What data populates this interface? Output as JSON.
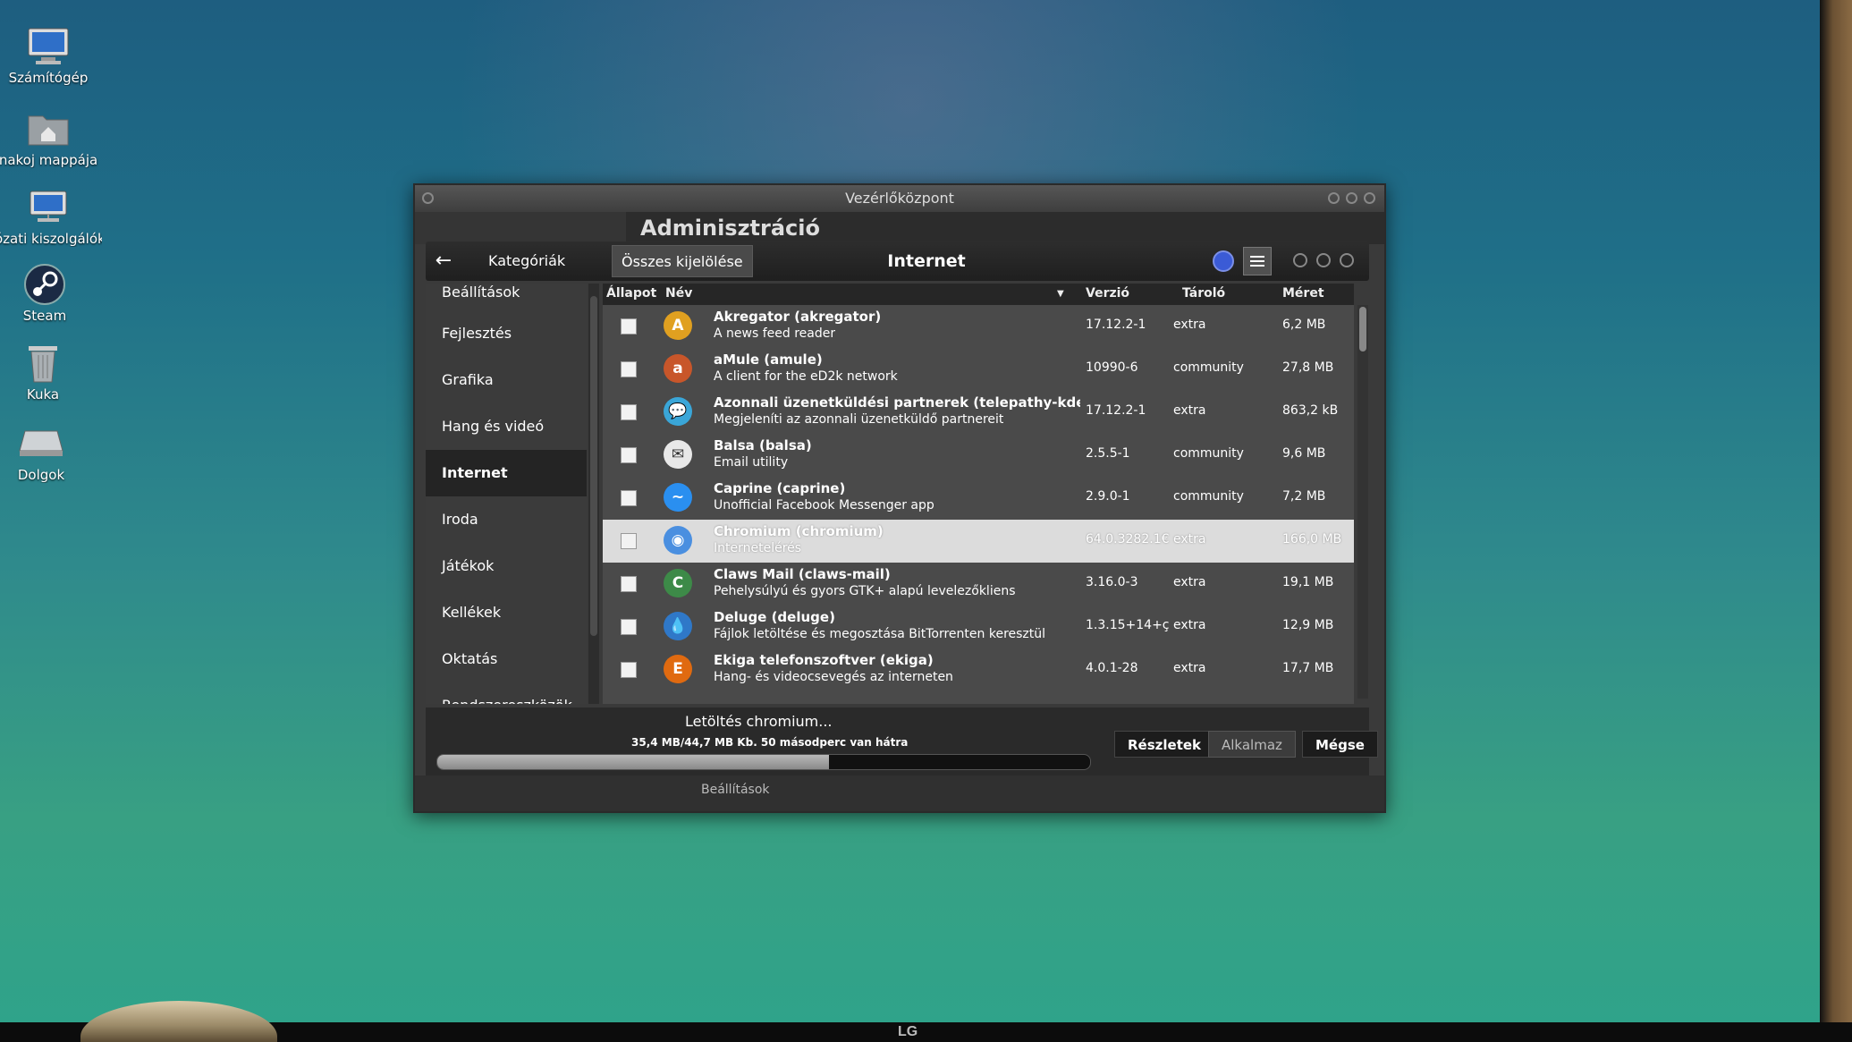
{
  "desktop": {
    "icons": [
      {
        "label": "Számítógép",
        "icon": "computer-icon"
      },
      {
        "label": "nakoj mappája",
        "icon": "home-folder-icon"
      },
      {
        "label": "ózati kiszolgálók",
        "icon": "network-icon"
      },
      {
        "label": "Steam",
        "icon": "steam-icon"
      },
      {
        "label": "Kuka",
        "icon": "trash-icon"
      },
      {
        "label": "Dolgok",
        "icon": "drive-icon"
      }
    ],
    "monitor_brand": "LG"
  },
  "window": {
    "title": "Vezérlőközpont",
    "section_title": "Adminisztráció"
  },
  "toolbar": {
    "back_icon": "back-arrow-icon",
    "categories_label": "Kategóriák",
    "select_all_label": "Összes kijelölése",
    "title": "Internet",
    "search_icon": "search-icon",
    "menu_icon": "hamburger-menu-icon"
  },
  "sidebar": {
    "items": [
      {
        "label": "Beállítások",
        "active": false
      },
      {
        "label": "Fejlesztés",
        "active": false
      },
      {
        "label": "Grafika",
        "active": false
      },
      {
        "label": "Hang és videó",
        "active": false
      },
      {
        "label": "Internet",
        "active": true
      },
      {
        "label": "Iroda",
        "active": false
      },
      {
        "label": "Játékok",
        "active": false
      },
      {
        "label": "Kellékek",
        "active": false
      },
      {
        "label": "Oktatás",
        "active": false
      },
      {
        "label": "Rendszereszközök",
        "active": false
      }
    ]
  },
  "table": {
    "headers": {
      "status": "Állapot",
      "name": "Név",
      "version": "Verzió",
      "repo": "Tároló",
      "size": "Méret"
    },
    "rows": [
      {
        "name": "Akregator  (akregator)",
        "desc": "A news feed reader",
        "version": "17.12.2-1",
        "repo": "extra",
        "size": "6,2 MB",
        "icon_color": "#e0a020",
        "icon_glyph": "A",
        "selected": false
      },
      {
        "name": "aMule  (amule)",
        "desc": "A client for the eD2k network",
        "version": "10990-6",
        "repo": "community",
        "size": "27,8 MB",
        "icon_color": "#c8562a",
        "icon_glyph": "a",
        "selected": false
      },
      {
        "name": "Azonnali üzenetküldési partnerek  (telepathy-kde",
        "desc": "Megjeleníti az azonnali üzenetküldő partnereit",
        "version": "17.12.2-1",
        "repo": "extra",
        "size": "863,2 kB",
        "icon_color": "#3aa6d8",
        "icon_glyph": "💬",
        "selected": false
      },
      {
        "name": "Balsa  (balsa)",
        "desc": "Email utility",
        "version": "2.5.5-1",
        "repo": "community",
        "size": "9,6 MB",
        "icon_color": "#e8e8e8",
        "icon_glyph": "✉",
        "selected": false
      },
      {
        "name": "Caprine  (caprine)",
        "desc": "Unofficial Facebook Messenger app",
        "version": "2.9.0-1",
        "repo": "community",
        "size": "7,2 MB",
        "icon_color": "#2a8ff0",
        "icon_glyph": "~",
        "selected": false
      },
      {
        "name": "Chromium  (chromium)",
        "desc": "Internetelérés",
        "version": "64.0.3282.1€",
        "repo": "extra",
        "size": "166,0 MB",
        "icon_color": "#4a8fe0",
        "icon_glyph": "◉",
        "selected": true
      },
      {
        "name": "Claws Mail  (claws-mail)",
        "desc": "Pehelysúlyú és gyors GTK+ alapú levelezőkliens",
        "version": "3.16.0-3",
        "repo": "extra",
        "size": "19,1 MB",
        "icon_color": "#3d8a48",
        "icon_glyph": "C",
        "selected": false
      },
      {
        "name": "Deluge  (deluge)",
        "desc": "Fájlok letöltése és megosztása BitTorrenten keresztül",
        "version": "1.3.15+14+ç",
        "repo": "extra",
        "size": "12,9 MB",
        "icon_color": "#2f78c8",
        "icon_glyph": "💧",
        "selected": false
      },
      {
        "name": "Ekiga telefonszoftver  (ekiga)",
        "desc": "Hang- és videocsevegés az interneten",
        "version": "4.0.1-28",
        "repo": "extra",
        "size": "17,7 MB",
        "icon_color": "#e06a10",
        "icon_glyph": "E",
        "selected": false
      }
    ]
  },
  "download": {
    "title": "Letöltés chromium...",
    "info": "35,4 MB/44,7 MB   Kb. 50 másodperc van hátra",
    "progress": 0.6
  },
  "buttons": {
    "details": "Részletek",
    "apply": "Alkalmaz",
    "cancel": "Mégse"
  },
  "underlay": {
    "label": "Beállítások"
  }
}
